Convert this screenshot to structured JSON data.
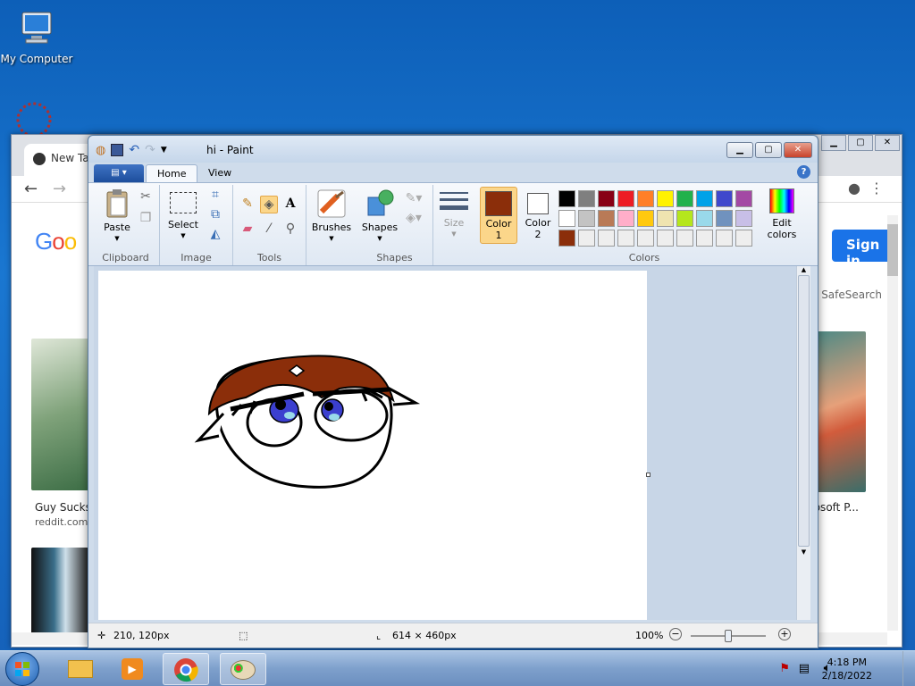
{
  "desktop": {
    "icons": [
      {
        "label": "My Computer"
      }
    ]
  },
  "chrome": {
    "tab_label": "New Ta",
    "sign_in": "Sign in",
    "safesearch": "SafeSearch",
    "result1_title": "Guy Sucks",
    "result1_source": "reddit.com",
    "result2_title": "osoft P..."
  },
  "paint": {
    "title": "hi - Paint",
    "tabs": [
      "Home",
      "View"
    ],
    "groups": {
      "clipboard": "Clipboard",
      "image": "Image",
      "tools": "Tools",
      "shapes": "Shapes",
      "colors": "Colors"
    },
    "buttons": {
      "paste": "Paste",
      "select": "Select",
      "brushes": "Brushes",
      "shapes": "Shapes",
      "size": "Size",
      "color1": [
        "Color",
        "1"
      ],
      "color2": [
        "Color",
        "2"
      ],
      "edit_colors": [
        "Edit",
        "colors"
      ]
    },
    "colors": {
      "color1": "#8b2e0a",
      "color2": "#ffffff",
      "palette_row1": [
        "#000000",
        "#7f7f7f",
        "#880015",
        "#ed1c24",
        "#ff7f27",
        "#fff200",
        "#22b14c",
        "#00a2e8",
        "#3f48cc",
        "#a349a4"
      ],
      "palette_row2": [
        "#ffffff",
        "#c3c3c3",
        "#b97a57",
        "#ffaec9",
        "#ffc90e",
        "#efe4b0",
        "#b5e61d",
        "#99d9ea",
        "#7092be",
        "#c8bfe7"
      ],
      "palette_row3": [
        "#8b2e0a",
        "#eeeeee",
        "#eeeeee",
        "#eeeeee",
        "#eeeeee",
        "#eeeeee",
        "#eeeeee",
        "#eeeeee",
        "#eeeeee",
        "#eeeeee"
      ]
    },
    "status": {
      "cursor": "210, 120px",
      "size": "614 × 460px",
      "zoom": "100%"
    }
  },
  "taskbar": {
    "time": "4:18 PM",
    "date": "2/18/2022"
  }
}
